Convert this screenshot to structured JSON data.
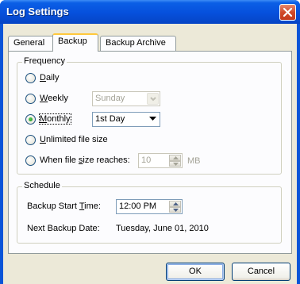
{
  "window": {
    "title": "Log Settings"
  },
  "tabs": [
    {
      "label": "General",
      "active": false
    },
    {
      "label": "Backup",
      "active": true
    },
    {
      "label": "Backup Archive",
      "active": false
    }
  ],
  "frequency": {
    "group_label": "Frequency",
    "options": {
      "daily": {
        "pre": "",
        "key": "D",
        "post": "aily"
      },
      "weekly": {
        "pre": "",
        "key": "W",
        "post": "eekly"
      },
      "monthly": {
        "pre": "",
        "key": "M",
        "post": "onthly"
      },
      "unlimited": {
        "pre": "",
        "key": "U",
        "post": "nlimited file size"
      },
      "when_size": {
        "pre": "When file ",
        "key": "s",
        "post": "ize reaches:"
      }
    },
    "selected": "monthly",
    "weekly_day": "Sunday",
    "monthly_day": "1st Day",
    "size_value": "10",
    "size_unit": "MB"
  },
  "schedule": {
    "group_label": "Schedule",
    "start_time_label": {
      "pre": "Backup Start ",
      "key": "T",
      "post": "ime:"
    },
    "start_time_value": "12:00 PM",
    "next_date_label": "Next Backup Date:",
    "next_date_value": "Tuesday, June 01, 2010"
  },
  "buttons": {
    "ok": "OK",
    "cancel": "Cancel"
  }
}
